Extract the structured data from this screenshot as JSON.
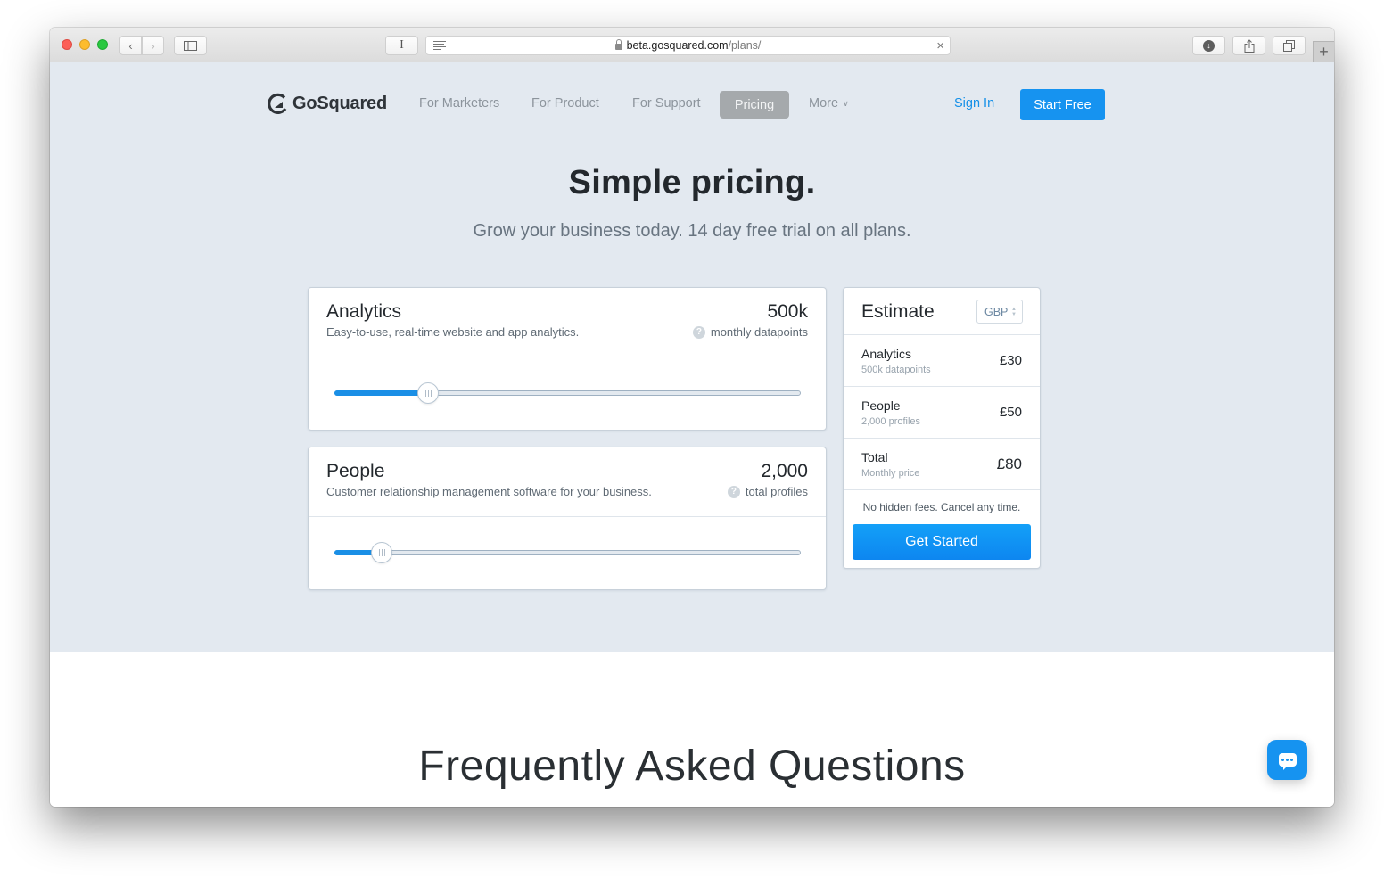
{
  "browser": {
    "url_domain": "beta.gosquared.com",
    "url_path": "/plans/",
    "reader_label": "I",
    "new_tab_label": "+",
    "clear_label": "×"
  },
  "nav": {
    "brand": "GoSquared",
    "links": [
      "For Marketers",
      "For Product",
      "For Support"
    ],
    "active": "Pricing",
    "more": "More",
    "sign_in": "Sign In",
    "start_free": "Start Free"
  },
  "hero": {
    "title": "Simple pricing.",
    "subtitle": "Grow your business today. 14 day free trial on all plans."
  },
  "products": [
    {
      "name": "Analytics",
      "description": "Easy-to-use, real-time website and app analytics.",
      "value": "500k",
      "unit": "monthly datapoints",
      "slider_fraction": 0.2
    },
    {
      "name": "People",
      "description": "Customer relationship management software for your business.",
      "value": "2,000",
      "unit": "total profiles",
      "slider_fraction": 0.1
    }
  ],
  "estimate": {
    "title": "Estimate",
    "currency": "GBP",
    "rows": [
      {
        "label": "Analytics",
        "sub": "500k datapoints",
        "price": "£30"
      },
      {
        "label": "People",
        "sub": "2,000 profiles",
        "price": "£50"
      },
      {
        "label": "Total",
        "sub": "Monthly price",
        "price": "£80"
      }
    ],
    "note": "No hidden fees. Cancel any time.",
    "cta": "Get Started"
  },
  "faq": {
    "title": "Frequently Asked Questions"
  },
  "help_glyph": "?"
}
